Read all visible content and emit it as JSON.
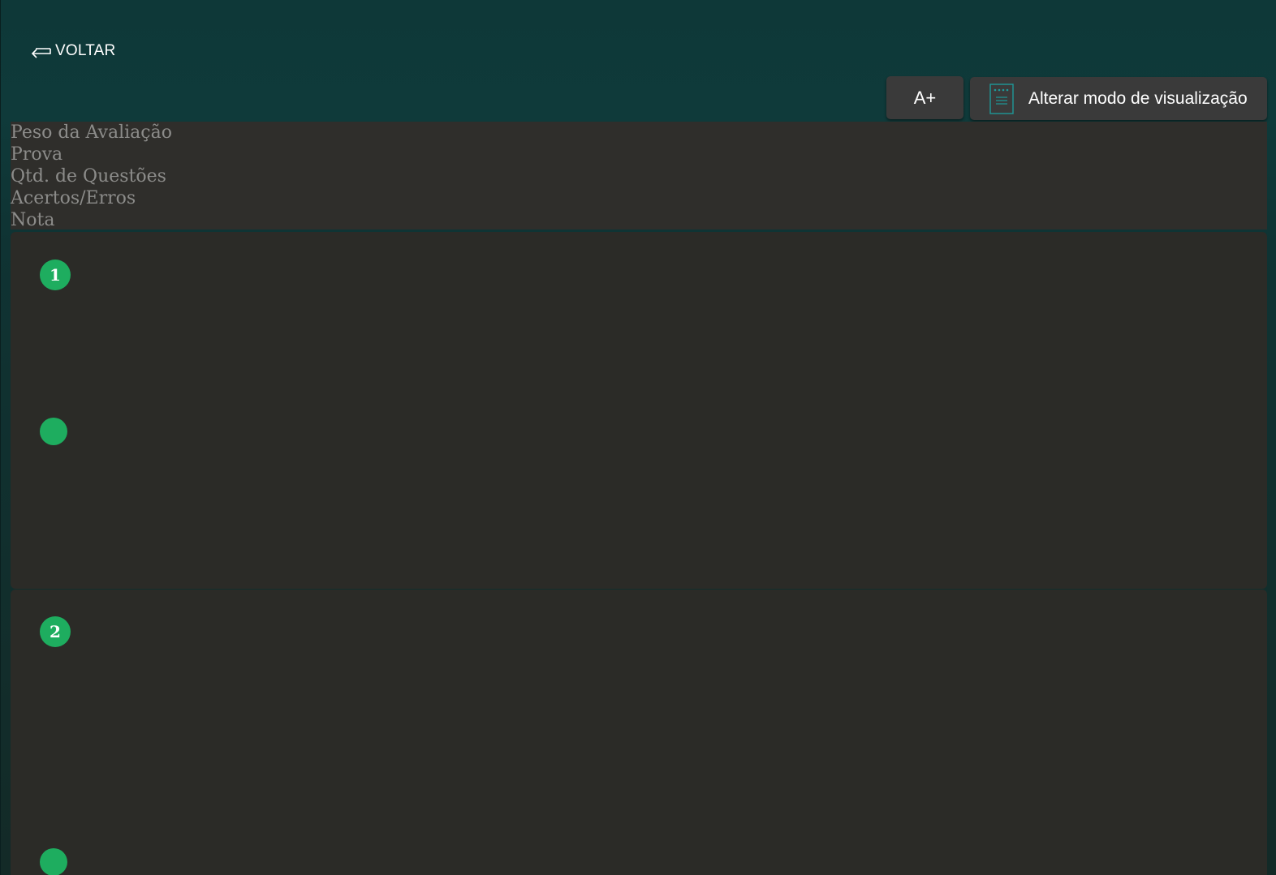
{
  "header": {
    "back_label": "VOLTAR",
    "font_size_button": "A+",
    "view_mode_button": "Alterar modo de visualização"
  },
  "info_panel": {
    "rows": [
      "Peso da Avaliação",
      "Prova",
      "Qtd. de Questões",
      "Acertos/Erros",
      "Nota"
    ]
  },
  "questions": [
    {
      "number": "1"
    },
    {
      "number": "2"
    }
  ],
  "colors": {
    "header_bg": "#0e3838",
    "panel_bg": "#2f2e2b",
    "card_bg": "#2b2b27",
    "button_bg": "#3a3a3a",
    "accent_green": "#1ead5f",
    "icon_teal": "#1e9a9a"
  },
  "icons": {
    "back": "return-arrow-icon",
    "view_mode": "document-icon"
  }
}
